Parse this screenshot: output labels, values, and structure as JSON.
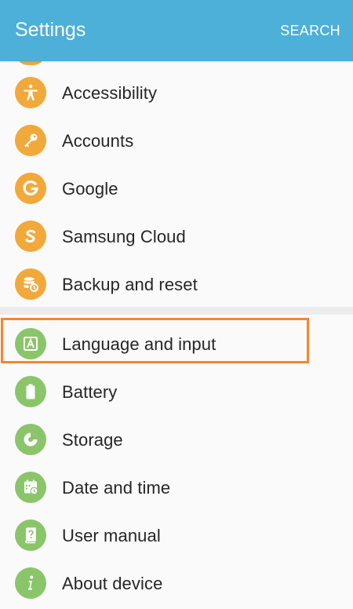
{
  "header": {
    "title": "Settings",
    "search_label": "SEARCH"
  },
  "colors": {
    "appbar": "#4cb0d8",
    "orange_icon": "#f2a93b",
    "green_icon": "#8bc56a",
    "highlight": "#f6862e"
  },
  "group1": [
    {
      "label": "Accessibility",
      "icon": "accessibility-icon"
    },
    {
      "label": "Accounts",
      "icon": "key-icon"
    },
    {
      "label": "Google",
      "icon": "google-icon"
    },
    {
      "label": "Samsung Cloud",
      "icon": "samsung-cloud-icon"
    },
    {
      "label": "Backup and reset",
      "icon": "backup-icon"
    }
  ],
  "group2": [
    {
      "label": "Language and input",
      "icon": "language-icon",
      "highlighted": true
    },
    {
      "label": "Battery",
      "icon": "battery-icon"
    },
    {
      "label": "Storage",
      "icon": "storage-icon"
    },
    {
      "label": "Date and time",
      "icon": "calendar-clock-icon"
    },
    {
      "label": "User manual",
      "icon": "user-manual-icon"
    },
    {
      "label": "About device",
      "icon": "info-icon"
    }
  ]
}
